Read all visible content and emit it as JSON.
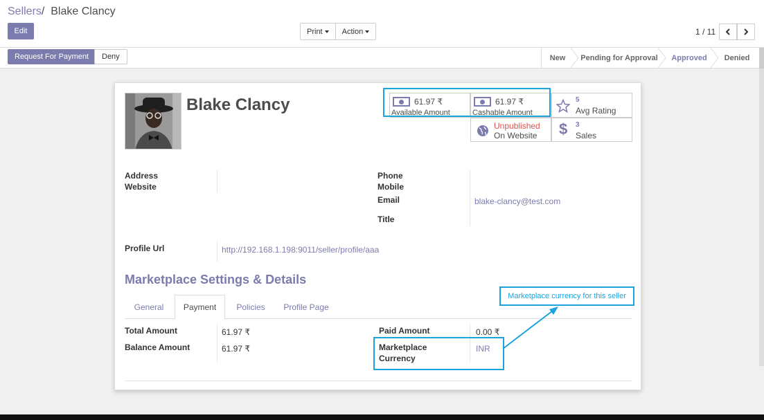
{
  "breadcrumb": {
    "parent": "Sellers",
    "separator": "/",
    "current": "Blake Clancy"
  },
  "buttons": {
    "edit": "Edit",
    "print": "Print",
    "action": "Action",
    "request_payment": "Request For Payment",
    "deny": "Deny"
  },
  "pager": {
    "text": "1 / 11"
  },
  "statusbar": {
    "stages": [
      "New",
      "Pending for Approval",
      "Approved",
      "Denied"
    ],
    "active": "Approved"
  },
  "seller": {
    "name": "Blake Clancy"
  },
  "stats": {
    "available_amount": "61.97 ₹",
    "available_label": "Available Amount",
    "cashable_amount": "61.97 ₹",
    "cashable_label": "Cashable Amount",
    "rating_value": "5",
    "rating_label": "Avg Rating",
    "website_status": "Unpublished",
    "website_label": "On Website",
    "sales_value": "3",
    "sales_label": "Sales"
  },
  "fields": {
    "address_label": "Address",
    "website_label": "Website",
    "phone_label": "Phone",
    "mobile_label": "Mobile",
    "email_label": "Email",
    "email_value": "blake-clancy@test.com",
    "title_label": "Title",
    "profile_url_label": "Profile Url",
    "profile_url_value": "http://192.168.1.198:9011/seller/profile/aaa"
  },
  "section": {
    "title": "Marketplace Settings & Details"
  },
  "tabs": [
    "General",
    "Payment",
    "Policies",
    "Profile Page"
  ],
  "active_tab": "Payment",
  "payment": {
    "total_label": "Total Amount",
    "total_value": "61.97 ₹",
    "balance_label": "Balance Amount",
    "balance_value": "61.97 ₹",
    "paid_label": "Paid Amount",
    "paid_value": "0.00 ₹",
    "currency_label_1": "Marketplace",
    "currency_label_2": "Currency",
    "currency_value": "INR"
  },
  "annotation": {
    "tooltip": "Marketplace currency for this seller"
  },
  "colors": {
    "brand": "#7c7bad",
    "highlight": "#1aa3e0",
    "unpublished": "#d9534f"
  }
}
